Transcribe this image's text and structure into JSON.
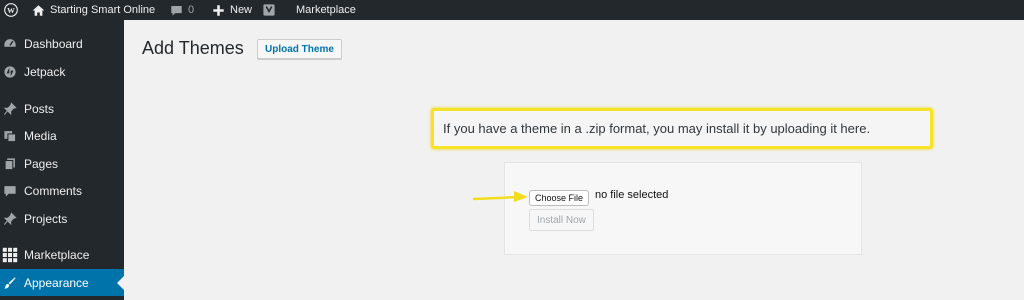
{
  "adminbar": {
    "site_name": "Starting Smart Online",
    "comments_count": "0",
    "new_label": "New",
    "marketplace_label": "Marketplace"
  },
  "sidebar": {
    "items": [
      {
        "label": "Dashboard",
        "icon": "dashboard-icon"
      },
      {
        "label": "Jetpack",
        "icon": "jetpack-icon"
      },
      {
        "label": "Posts",
        "icon": "pin-icon"
      },
      {
        "label": "Media",
        "icon": "media-icon"
      },
      {
        "label": "Pages",
        "icon": "pages-icon"
      },
      {
        "label": "Comments",
        "icon": "comment-icon"
      },
      {
        "label": "Projects",
        "icon": "pin-icon"
      },
      {
        "label": "Marketplace",
        "icon": "grid-icon"
      },
      {
        "label": "Appearance",
        "icon": "brush-icon",
        "active": true
      }
    ]
  },
  "main": {
    "title": "Add Themes",
    "upload_button": "Upload Theme",
    "callout_text": "If you have a theme in a .zip format, you may install it by uploading it here.",
    "choose_file": "Choose File",
    "no_file": "no file selected",
    "install_now": "Install Now"
  },
  "colors": {
    "adminbar_bg": "#23282d",
    "active_menu": "#0073aa",
    "highlight": "#f7e325"
  }
}
